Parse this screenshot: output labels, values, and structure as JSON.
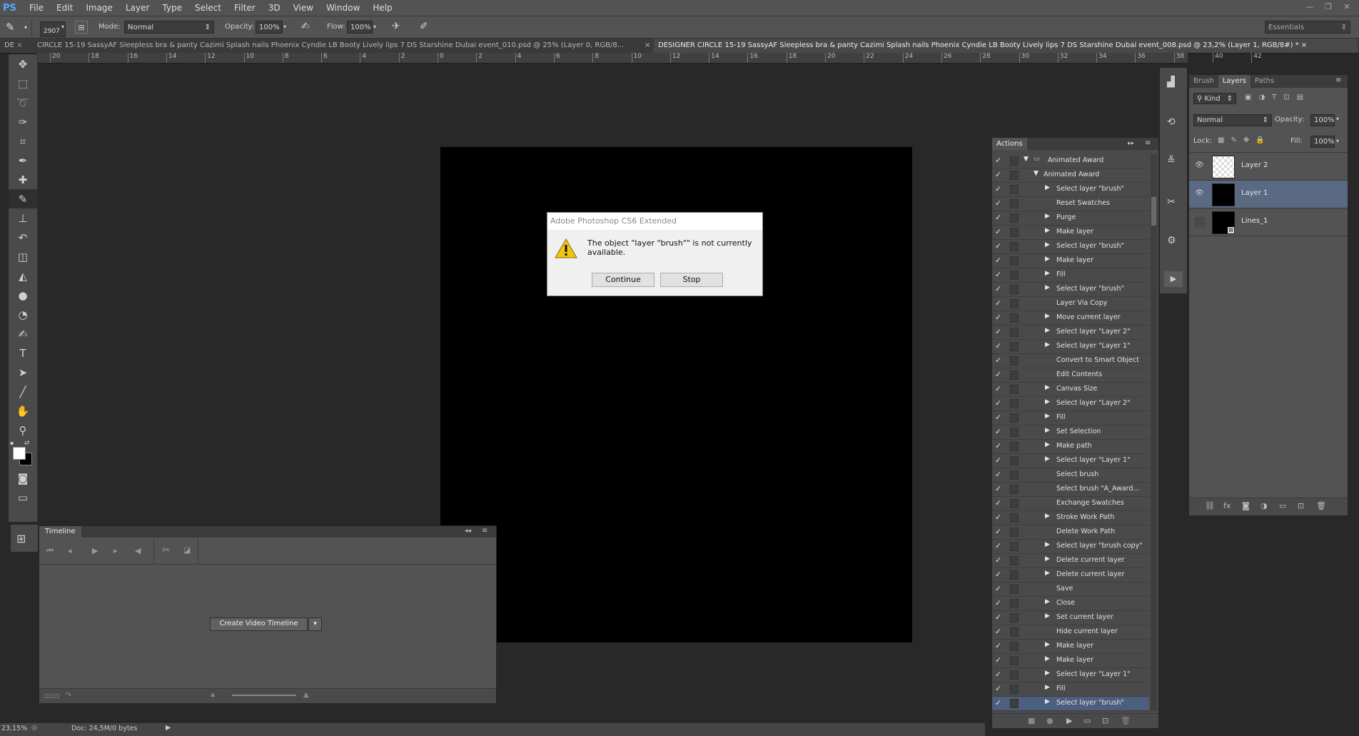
{
  "menubar": {
    "logo": "PS",
    "items": [
      "File",
      "Edit",
      "Image",
      "Layer",
      "Type",
      "Select",
      "Filter",
      "3D",
      "View",
      "Window",
      "Help"
    ]
  },
  "options": {
    "brush_size": "2907",
    "mode_label": "Mode:",
    "mode_value": "Normal",
    "opacity_label": "Opacity:",
    "opacity_value": "100%",
    "flow_label": "Flow:",
    "flow_value": "100%",
    "workspace": "Essentials"
  },
  "tabs": [
    {
      "label": "DE",
      "active": false
    },
    {
      "label": "CIRCLE 15-19 SassyAF Sleepless bra & panty Cazimi Splash nails Phoenix Cyndie LB Booty Lively lips 7 DS Starshine Dubai event_010.psd @ 25% (Layer 0, RGB/8...",
      "active": false
    },
    {
      "label": "DESIGNER CIRCLE 15-19 SassyAF Sleepless bra & panty Cazimi Splash nails Phoenix Cyndie LB Booty Lively lips 7 DS Starshine Dubai event_008.psd @ 23,2% (Layer 1, RGB/8#) *",
      "active": true
    }
  ],
  "ruler_ticks": [
    "20",
    "18",
    "16",
    "14",
    "12",
    "10",
    "8",
    "6",
    "4",
    "2",
    "0",
    "2",
    "4",
    "6",
    "8",
    "10",
    "12",
    "14",
    "16",
    "18",
    "20",
    "22",
    "24",
    "26",
    "28",
    "30",
    "32",
    "34",
    "36",
    "38",
    "40",
    "42"
  ],
  "dialog": {
    "title": "Adobe Photoshop CS6 Extended",
    "message": "The object \"layer \"brush\"\" is not currently available.",
    "continue_label": "Continue",
    "stop_label": "Stop"
  },
  "timeline": {
    "tab": "Timeline",
    "create_button": "Create Video Timeline"
  },
  "actions": {
    "tab": "Actions",
    "items": [
      {
        "label": "Animated Award",
        "level": 0,
        "expanded": true,
        "folder": true
      },
      {
        "label": "Animated Award",
        "level": 1,
        "expanded": true
      },
      {
        "label": "Select layer \"brush\"",
        "level": 2,
        "arrow": true
      },
      {
        "label": "Reset Swatches",
        "level": 2,
        "arrow": false
      },
      {
        "label": "Purge",
        "level": 2,
        "arrow": true
      },
      {
        "label": "Make layer",
        "level": 2,
        "arrow": true
      },
      {
        "label": "Select layer \"brush\"",
        "level": 2,
        "arrow": true
      },
      {
        "label": "Make layer",
        "level": 2,
        "arrow": true
      },
      {
        "label": "Fill",
        "level": 2,
        "arrow": true
      },
      {
        "label": "Select layer \"brush\"",
        "level": 2,
        "arrow": true
      },
      {
        "label": "Layer Via Copy",
        "level": 2,
        "arrow": false
      },
      {
        "label": "Move current layer",
        "level": 2,
        "arrow": true
      },
      {
        "label": "Select layer \"Layer 2\"",
        "level": 2,
        "arrow": true
      },
      {
        "label": "Select layer \"Layer 1\"",
        "level": 2,
        "arrow": true
      },
      {
        "label": "Convert to Smart Object",
        "level": 2,
        "arrow": false
      },
      {
        "label": "Edit Contents",
        "level": 2,
        "arrow": false
      },
      {
        "label": "Canvas Size",
        "level": 2,
        "arrow": true
      },
      {
        "label": "Select layer \"Layer 2\"",
        "level": 2,
        "arrow": true
      },
      {
        "label": "Fill",
        "level": 2,
        "arrow": true
      },
      {
        "label": "Set Selection",
        "level": 2,
        "arrow": true
      },
      {
        "label": "Make path",
        "level": 2,
        "arrow": true
      },
      {
        "label": "Select layer \"Layer 1\"",
        "level": 2,
        "arrow": true
      },
      {
        "label": "Select brush",
        "level": 2,
        "arrow": false
      },
      {
        "label": "Select brush \"A_Award...",
        "level": 2,
        "arrow": false
      },
      {
        "label": "Exchange Swatches",
        "level": 2,
        "arrow": false
      },
      {
        "label": "Stroke Work Path",
        "level": 2,
        "arrow": true
      },
      {
        "label": "Delete Work Path",
        "level": 2,
        "arrow": false
      },
      {
        "label": "Select layer \"brush copy\"",
        "level": 2,
        "arrow": true
      },
      {
        "label": "Delete current layer",
        "level": 2,
        "arrow": true
      },
      {
        "label": "Delete current layer",
        "level": 2,
        "arrow": true
      },
      {
        "label": "Save",
        "level": 2,
        "arrow": false
      },
      {
        "label": "Close",
        "level": 2,
        "arrow": true
      },
      {
        "label": "Set current layer",
        "level": 2,
        "arrow": true
      },
      {
        "label": "Hide current layer",
        "level": 2,
        "arrow": false
      },
      {
        "label": "Make layer",
        "level": 2,
        "arrow": true
      },
      {
        "label": "Make layer",
        "level": 2,
        "arrow": true
      },
      {
        "label": "Select layer \"Layer 1\"",
        "level": 2,
        "arrow": true
      },
      {
        "label": "Fill",
        "level": 2,
        "arrow": true
      },
      {
        "label": "Select layer \"brush\"",
        "level": 2,
        "arrow": true,
        "highlight": true
      }
    ]
  },
  "layers_panel": {
    "tabs": [
      "Brush",
      "Layers",
      "Paths"
    ],
    "kind_label": "Kind",
    "blend_mode": "Normal",
    "opacity_label": "Opacity:",
    "opacity_value": "100%",
    "lock_label": "Lock:",
    "fill_label": "Fill:",
    "fill_value": "100%",
    "layers": [
      {
        "name": "Layer 2",
        "visible": true,
        "selected": false,
        "thumb": "transparent"
      },
      {
        "name": "Layer 1",
        "visible": true,
        "selected": true,
        "thumb": "black"
      },
      {
        "name": "Lines_1",
        "visible": false,
        "selected": false,
        "thumb": "black-smart"
      }
    ]
  },
  "status": {
    "zoom": "23,15%",
    "doc": "Doc: 24,5M/0 bytes"
  },
  "colors": {
    "accent_selected": "#5a6a82",
    "highlight_action": "#4d5f7e"
  }
}
